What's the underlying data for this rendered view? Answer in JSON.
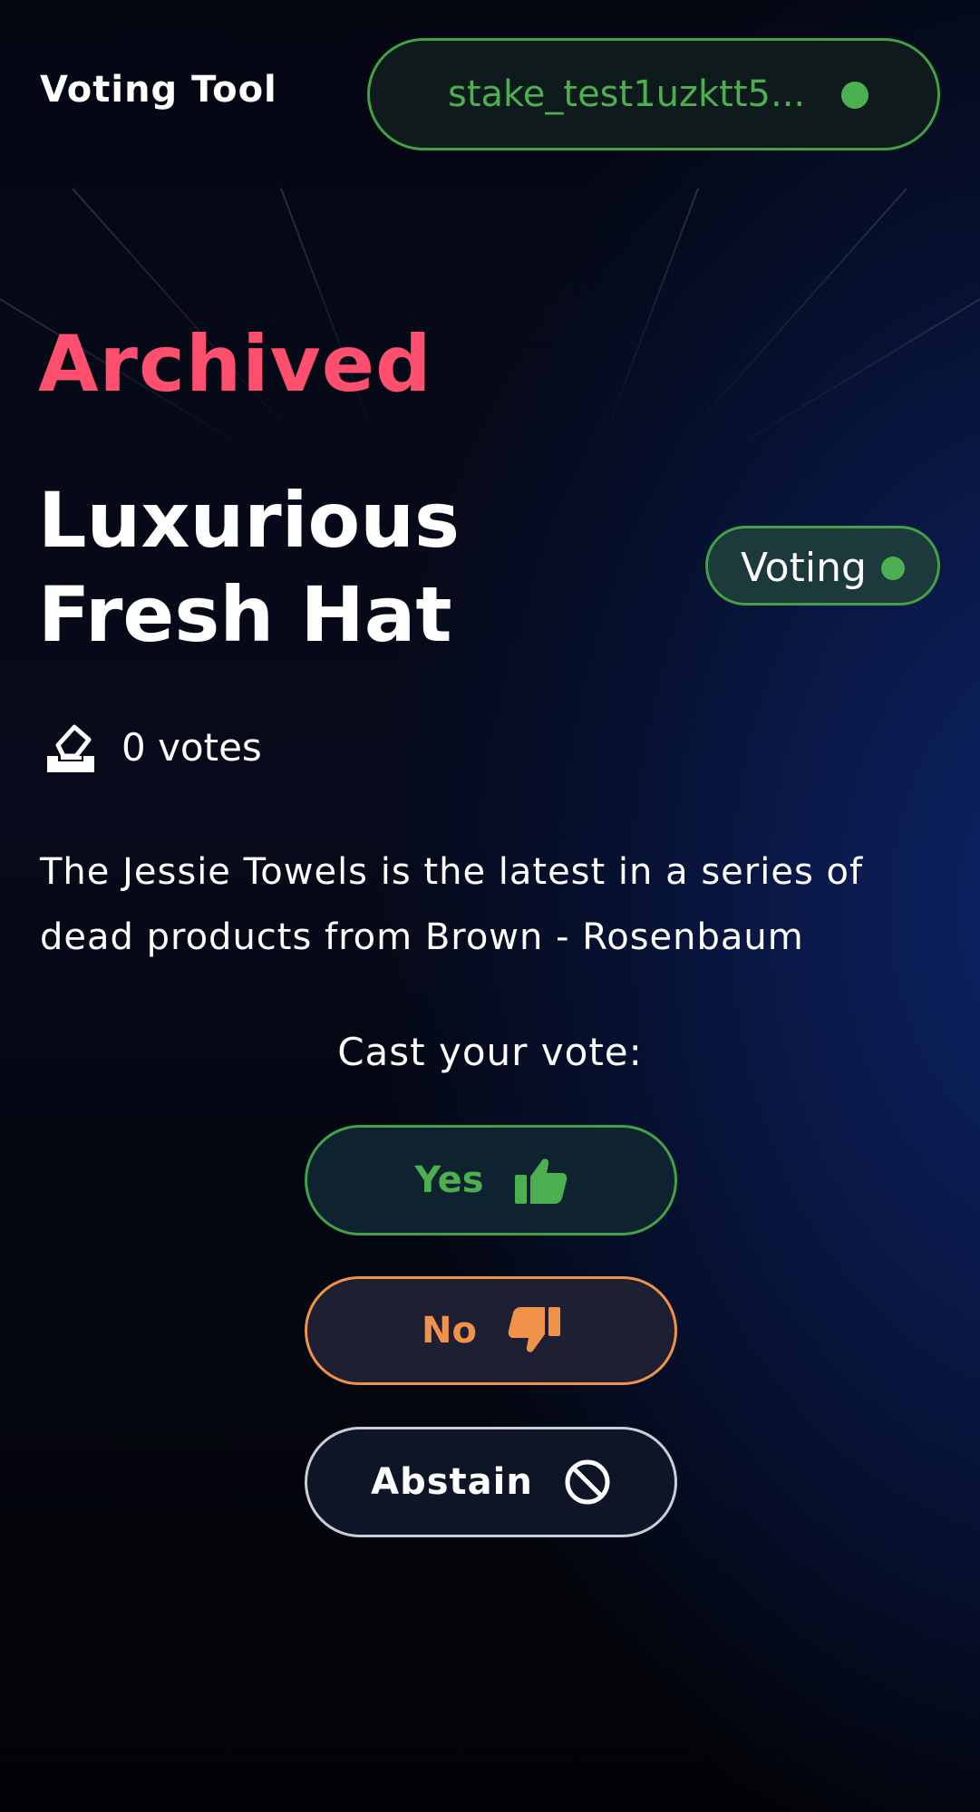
{
  "header": {
    "brand": "Voting Tool",
    "wallet_address": "stake_test1uzktt5...",
    "wallet_status_color": "#4caf50"
  },
  "proposal": {
    "status_heading": "Archived",
    "title": "Luxurious Fresh Hat",
    "state_badge": "Voting",
    "votes_label": "0 votes",
    "description": "The Jessie Towels is the latest in a series of dead products from Brown - Rosenbaum"
  },
  "vote": {
    "prompt": "Cast your vote:",
    "options": [
      {
        "label": "Yes",
        "icon": "thumbs-up-icon",
        "color": "#4caf50"
      },
      {
        "label": "No",
        "icon": "thumbs-down-icon",
        "color": "#f0924a"
      },
      {
        "label": "Abstain",
        "icon": "ban-icon",
        "color": "#ffffff"
      }
    ]
  },
  "colors": {
    "archived": "#ff4f6e",
    "accent_green": "#43a047",
    "accent_orange": "#f0924a",
    "background": "#03050c"
  }
}
